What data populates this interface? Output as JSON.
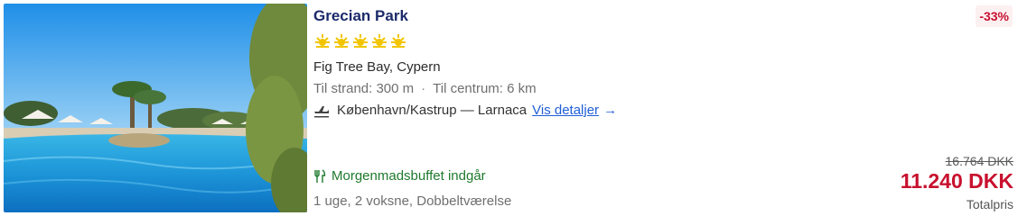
{
  "hotel": {
    "name": "Grecian Park",
    "star_rating": 5,
    "star_icon": "sun-icon",
    "star_color": "#f2c500",
    "location": "Fig Tree Bay, Cypern",
    "beach_distance": "Til strand: 300 m",
    "separator": "·",
    "center_distance": "Til centrum: 6 km"
  },
  "flight": {
    "icon": "airplane-icon",
    "route": "København/Kastrup — Larnaca",
    "details_link": "Vis detaljer",
    "link_arrow": "→",
    "link_color": "#1f5fd6"
  },
  "board": {
    "icon": "fork-knife-icon",
    "label": "Morgenmadsbuffet indgår",
    "color": "#1e7a2c"
  },
  "occupancy": "1 uge, 2 voksne, Dobbeltværelse",
  "pricing": {
    "discount": "-33%",
    "old_price": "16.764 DKK",
    "new_price": "11.240 DKK",
    "price_label": "Totalpris",
    "accent_color": "#c8102e"
  }
}
